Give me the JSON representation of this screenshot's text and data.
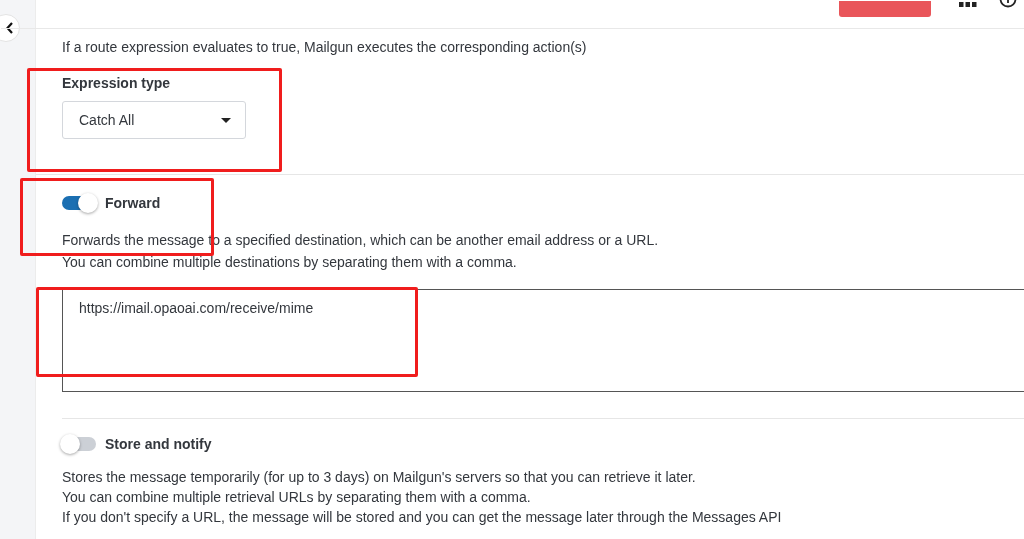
{
  "intro": {
    "text": "If a route expression evaluates to true, Mailgun executes the corresponding action(s)"
  },
  "expression_type": {
    "label": "Expression type",
    "value": "Catch All",
    "highlighted": true
  },
  "actions": [
    {
      "label": "Forward",
      "on": true,
      "highlighted": true,
      "description": [
        "Forwards the message to a specified destination, which can be another email address or a URL.",
        "You can combine multiple destinations by separating them with a comma."
      ],
      "field": {
        "value": "https://imail.opaoai.com/receive/mime",
        "highlighted": true
      }
    },
    {
      "label": "Store and notify",
      "on": false,
      "description": [
        "Stores the message temporarily (for up to 3 days) on Mailgun's servers so that you can retrieve it later.",
        "You can combine multiple retrieval URLs by separating them with a comma.",
        "If you don't specify a URL, the message will be stored and you can get the message later through the Messages API"
      ]
    }
  ]
}
